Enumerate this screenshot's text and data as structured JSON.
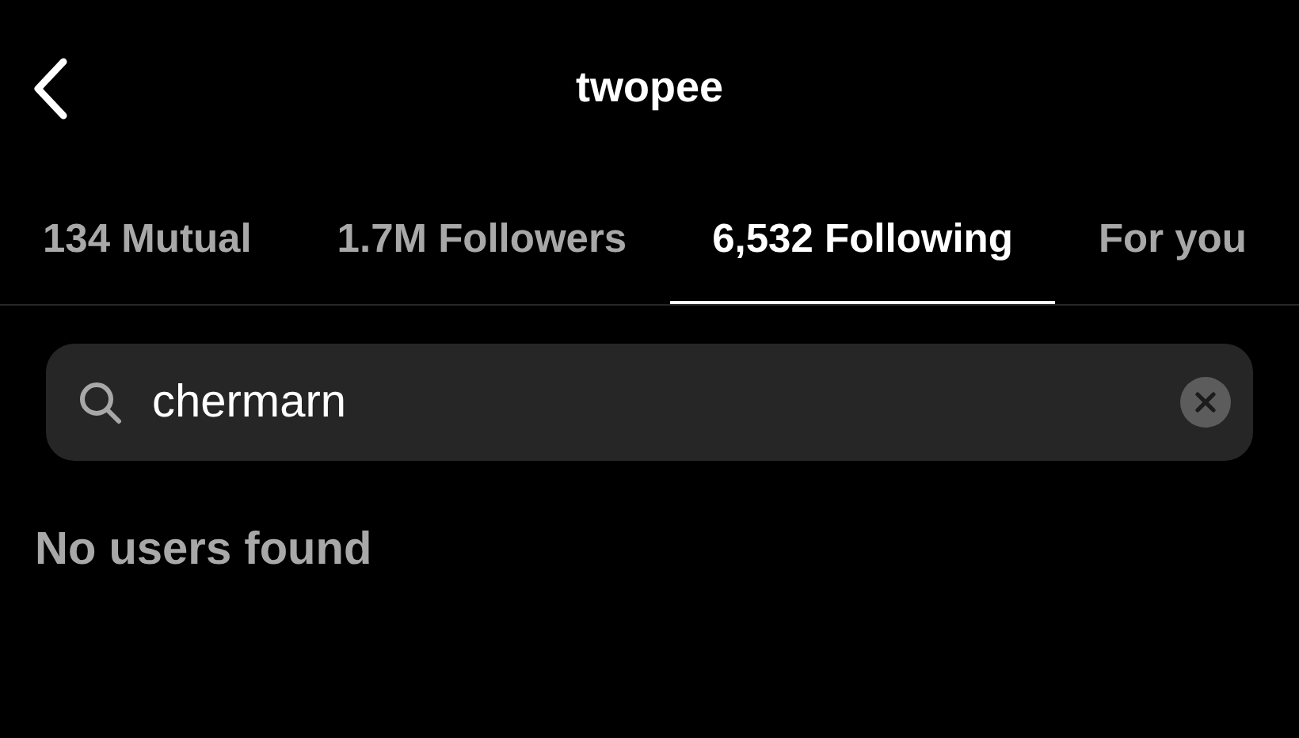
{
  "header": {
    "title": "twopee"
  },
  "tabs": [
    {
      "label": "134 Mutual",
      "selected": false
    },
    {
      "label": "1.7M Followers",
      "selected": false
    },
    {
      "label": "6,532 Following",
      "selected": true
    },
    {
      "label": "For you",
      "selected": false
    }
  ],
  "search": {
    "value": "chermarn"
  },
  "message": "No users found"
}
